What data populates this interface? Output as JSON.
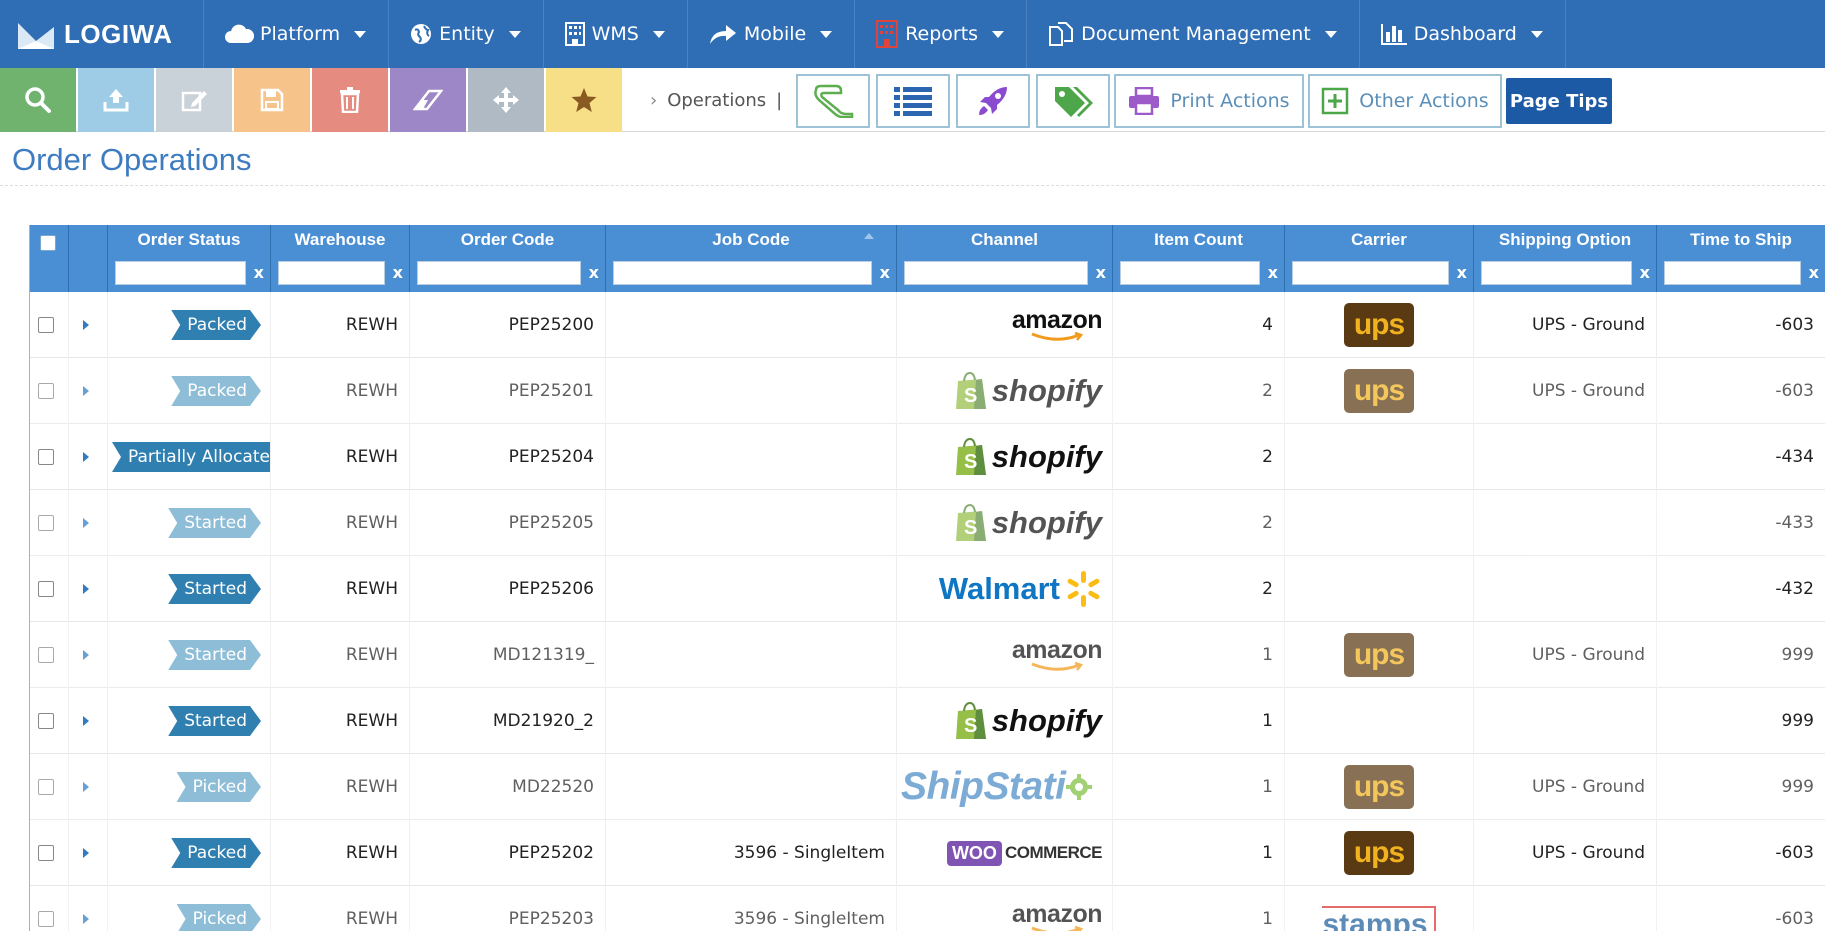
{
  "brand": {
    "name": "LOGIWA"
  },
  "nav": [
    {
      "label": "Platform",
      "icon": "cloud-icon"
    },
    {
      "label": "Entity",
      "icon": "globe-icon"
    },
    {
      "label": "WMS",
      "icon": "building-icon"
    },
    {
      "label": "Mobile",
      "icon": "share-arrow-icon"
    },
    {
      "label": "Reports",
      "icon": "report-icon"
    },
    {
      "label": "Document Management",
      "icon": "documents-icon"
    },
    {
      "label": "Dashboard",
      "icon": "bar-chart-icon"
    }
  ],
  "toolbar": {
    "buttons": [
      {
        "name": "search-icon",
        "color": "#6fb36f"
      },
      {
        "name": "upload-icon",
        "color": "#9ecbe6"
      },
      {
        "name": "edit-icon",
        "color": "#c9d1d9"
      },
      {
        "name": "save-icon",
        "color": "#f6c48a"
      },
      {
        "name": "delete-icon",
        "color": "#e58b7f"
      },
      {
        "name": "eraser-icon",
        "color": "#9d87c6"
      },
      {
        "name": "move-icon",
        "color": "#b0bac4"
      },
      {
        "name": "star-icon",
        "color": "#f6df87"
      }
    ],
    "breadcrumb": "Operations",
    "print_actions": "Print Actions",
    "other_actions": "Other Actions",
    "page_tips": "Page Tips"
  },
  "page": {
    "title": "Order Operations"
  },
  "grid": {
    "columns": [
      "Order Status",
      "Warehouse",
      "Order Code",
      "Job Code",
      "Channel",
      "Item Count",
      "Carrier",
      "Shipping Option",
      "Time to Ship"
    ],
    "rows": [
      {
        "status": "Packed",
        "status_tone": "dark",
        "warehouse": "REWH",
        "order_code": "PEP25200",
        "job_code": "",
        "channel": "amazon",
        "item_count": "4",
        "carrier": "ups",
        "shipping": "UPS - Ground",
        "time_to_ship": "-603",
        "dim": false
      },
      {
        "status": "Packed",
        "status_tone": "light",
        "warehouse": "REWH",
        "order_code": "PEP25201",
        "job_code": "",
        "channel": "shopify",
        "item_count": "2",
        "carrier": "ups",
        "shipping": "UPS - Ground",
        "time_to_ship": "-603",
        "dim": true
      },
      {
        "status": "Partially Allocated",
        "status_tone": "dark",
        "warehouse": "REWH",
        "order_code": "PEP25204",
        "job_code": "",
        "channel": "shopify",
        "item_count": "2",
        "carrier": "",
        "shipping": "",
        "time_to_ship": "-434",
        "dim": false
      },
      {
        "status": "Started",
        "status_tone": "light",
        "warehouse": "REWH",
        "order_code": "PEP25205",
        "job_code": "",
        "channel": "shopify",
        "item_count": "2",
        "carrier": "",
        "shipping": "",
        "time_to_ship": "-433",
        "dim": true
      },
      {
        "status": "Started",
        "status_tone": "dark",
        "warehouse": "REWH",
        "order_code": "PEP25206",
        "job_code": "",
        "channel": "Walmart",
        "item_count": "2",
        "carrier": "",
        "shipping": "",
        "time_to_ship": "-432",
        "dim": false
      },
      {
        "status": "Started",
        "status_tone": "light",
        "warehouse": "REWH",
        "order_code": "MD121319_",
        "job_code": "",
        "channel": "amazon",
        "item_count": "1",
        "carrier": "ups",
        "shipping": "UPS - Ground",
        "time_to_ship": "999",
        "dim": true
      },
      {
        "status": "Started",
        "status_tone": "dark",
        "warehouse": "REWH",
        "order_code": "MD21920_2",
        "job_code": "",
        "channel": "shopify",
        "item_count": "1",
        "carrier": "",
        "shipping": "",
        "time_to_ship": "999",
        "dim": false
      },
      {
        "status": "Picked",
        "status_tone": "light",
        "warehouse": "REWH",
        "order_code": "MD22520",
        "job_code": "",
        "channel": "ShipStation",
        "item_count": "1",
        "carrier": "ups",
        "shipping": "UPS - Ground",
        "time_to_ship": "999",
        "dim": true
      },
      {
        "status": "Packed",
        "status_tone": "dark",
        "warehouse": "REWH",
        "order_code": "PEP25202",
        "job_code": "3596 - SingleItem",
        "channel": "WooCommerce",
        "item_count": "1",
        "carrier": "ups",
        "shipping": "UPS - Ground",
        "time_to_ship": "-603",
        "dim": false
      },
      {
        "status": "Picked",
        "status_tone": "light",
        "warehouse": "REWH",
        "order_code": "PEP25203",
        "job_code": "3596 - SingleItem",
        "channel": "amazon",
        "item_count": "1",
        "carrier": "stamps",
        "shipping": "",
        "time_to_ship": "-603",
        "dim": true
      }
    ]
  },
  "logos": {
    "amazon": "amazon",
    "shopify": "shopify",
    "walmart": "Walmart",
    "shipstation": "ShipStati",
    "woo": "WOO",
    "commerce": "COMMERCE",
    "ups": "ups",
    "stamps": "stamps"
  },
  "colors": {
    "nav_bg": "#2f6db5",
    "header_bg": "#4a8fd4",
    "status_dark": "#2f7fb0",
    "status_light": "#64a6c9",
    "title": "#3d7cc0"
  }
}
